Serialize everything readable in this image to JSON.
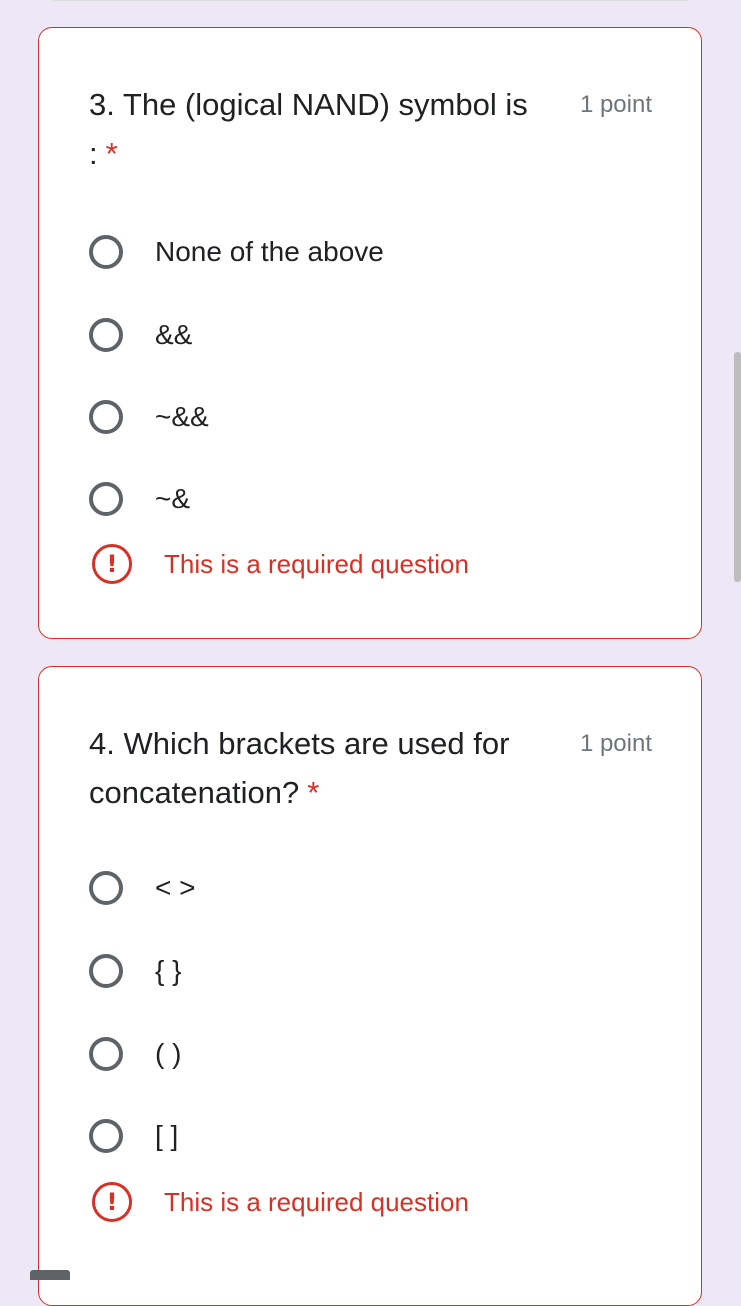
{
  "questions": [
    {
      "title": "3. The (logical NAND) symbol is :",
      "required_mark": "*",
      "points": "1 point",
      "options": [
        "None of the above",
        "&&",
        "~&&",
        "~&"
      ],
      "error_text": "This is a required question",
      "error_icon": "exclamation-circle-icon"
    },
    {
      "title": "4. Which brackets are used for concatenation?",
      "required_mark": "*",
      "points": "1 point",
      "options": [
        "< >",
        "{ }",
        "( )",
        "[ ]"
      ],
      "error_text": "This is a required question",
      "error_icon": "exclamation-circle-icon"
    }
  ],
  "colors": {
    "page_background": "#ede7f6",
    "error_red": "#d93025",
    "radio_gray": "#5f6368",
    "text": "#202124",
    "muted_text": "#70757a"
  }
}
